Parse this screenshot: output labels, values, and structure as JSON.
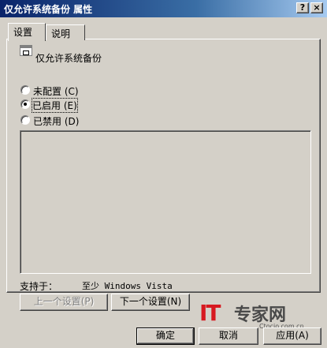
{
  "window": {
    "title": "仅允许系统备份 属性",
    "help_label": "?",
    "close_label": "×"
  },
  "tabs": [
    {
      "label": "设置"
    },
    {
      "label": "说明"
    }
  ],
  "policy": {
    "name": "仅允许系统备份",
    "icon": "policy-setting-icon"
  },
  "options": [
    {
      "label": "未配置",
      "mnemonic": "(C)",
      "checked": false
    },
    {
      "label": "已启用",
      "mnemonic": "(E)",
      "checked": true
    },
    {
      "label": "已禁用",
      "mnemonic": "(D)",
      "checked": false
    }
  ],
  "supported": {
    "label": "支持于：",
    "value": "至少 Windows Vista"
  },
  "nav_buttons": {
    "prev_label": "上一个设置(P)",
    "next_label": "下一个设置(N)"
  },
  "dialog_buttons": {
    "ok_label": "确定",
    "cancel_label": "取消",
    "apply_label": "应用(A)"
  },
  "watermark": {
    "brand_it": "IT",
    "brand_cn": "专家网",
    "url": "Ctocio.com.cn"
  },
  "colors": {
    "titlebar_start": "#0a246a",
    "titlebar_end": "#a6caf0",
    "face": "#d4d0c8",
    "watermark_red": "#d71920"
  }
}
